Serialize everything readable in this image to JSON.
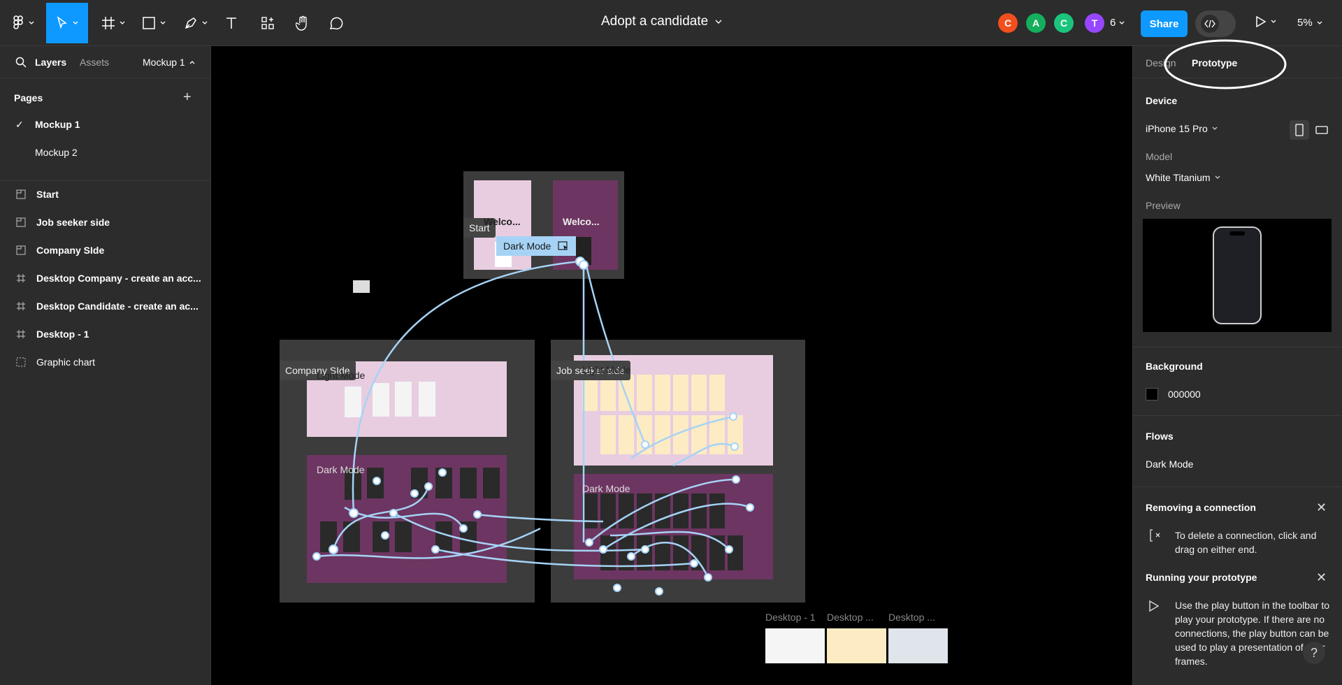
{
  "toolbar": {
    "document_title": "Adopt a candidate",
    "share_label": "Share",
    "presence_count": "6",
    "zoom": "5%",
    "avatars": [
      {
        "letter": "C",
        "color": "#f24e1e"
      },
      {
        "letter": "A",
        "color": "#14ae5c"
      },
      {
        "letter": "C",
        "color": "#1bc47d"
      },
      {
        "letter": "T",
        "color": "#9747ff"
      }
    ]
  },
  "left_panel": {
    "tabs": {
      "layers": "Layers",
      "assets": "Assets",
      "page_switch": "Mockup 1"
    },
    "pages_heading": "Pages",
    "pages": [
      "Mockup 1",
      "Mockup 2"
    ],
    "layers": [
      {
        "label": "Start",
        "icon": "section-icon"
      },
      {
        "label": "Job seeker side",
        "icon": "section-icon"
      },
      {
        "label": "Company SIde",
        "icon": "section-icon"
      },
      {
        "label": "Desktop Company - create an acc...",
        "icon": "frame-icon"
      },
      {
        "label": "Desktop Candidate - create an ac...",
        "icon": "frame-icon"
      },
      {
        "label": "Desktop - 1",
        "icon": "frame-icon"
      },
      {
        "label": "Graphic chart",
        "icon": "group-icon"
      }
    ]
  },
  "canvas": {
    "sections": {
      "start": "Start",
      "company": "Company SIde",
      "job_seeker": "Job seeker side"
    },
    "welcome_1": "Welco...",
    "welcome_2": "Welco...",
    "flow_tag": "Dark Mode",
    "light_mode": "Light Mode",
    "dark_mode": "Dark Mode",
    "thumbnails": [
      "Desktop - 1",
      "Desktop ...",
      "Desktop ..."
    ]
  },
  "right_panel": {
    "tabs": {
      "design": "Design",
      "prototype": "Prototype"
    },
    "device_heading": "Device",
    "device_value": "iPhone 15 Pro",
    "model_label": "Model",
    "model_value": "White Titanium",
    "preview_label": "Preview",
    "background_heading": "Background",
    "background_value": "000000",
    "flows_heading": "Flows",
    "flow_item": "Dark Mode",
    "hint1_title": "Removing a connection",
    "hint1_body": "To delete a connection, click and drag on either end.",
    "hint2_title": "Running your prototype",
    "hint2_body": "Use the play button in the toolbar to play your prototype. If there are no connections, the play button can be used to play a presentation of your frames."
  },
  "help_label": "?"
}
